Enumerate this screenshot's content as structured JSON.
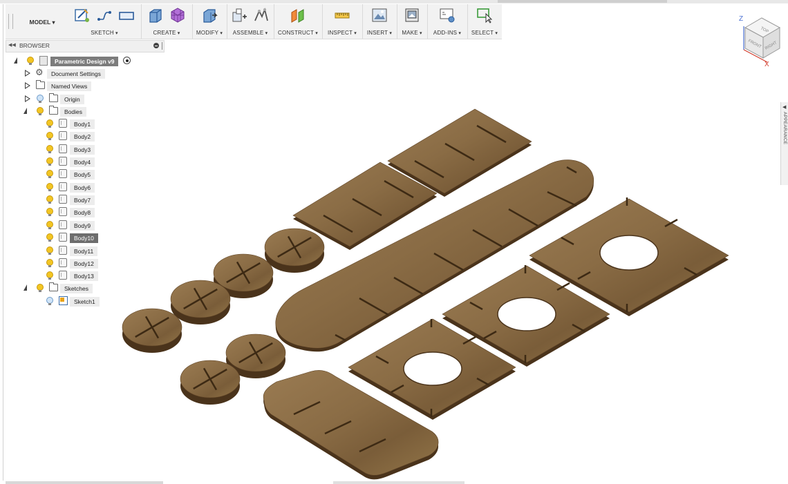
{
  "toolbar": {
    "workspace": "MODEL",
    "groups": [
      {
        "label": "SKETCH",
        "icons": [
          "create-sketch-icon",
          "line-icon",
          "rectangle-icon"
        ]
      },
      {
        "label": "CREATE",
        "icons": [
          "extrude-icon",
          "box-icon"
        ]
      },
      {
        "label": "MODIFY",
        "icons": [
          "press-pull-icon"
        ]
      },
      {
        "label": "ASSEMBLE",
        "icons": [
          "new-component-icon",
          "joint-icon"
        ]
      },
      {
        "label": "CONSTRUCT",
        "icons": [
          "offset-plane-icon"
        ]
      },
      {
        "label": "INSPECT",
        "icons": [
          "measure-icon"
        ]
      },
      {
        "label": "INSERT",
        "icons": [
          "insert-image-icon"
        ]
      },
      {
        "label": "MAKE",
        "icons": [
          "3d-print-icon"
        ]
      },
      {
        "label": "ADD-INS",
        "icons": [
          "scripts-icon"
        ]
      },
      {
        "label": "SELECT",
        "icons": [
          "select-icon"
        ]
      }
    ]
  },
  "browser": {
    "title": "BROWSER",
    "root": "Parametric Design v9",
    "document_settings": "Document Settings",
    "named_views": "Named Views",
    "origin": "Origin",
    "bodies_folder": "Bodies",
    "bodies": [
      "Body1",
      "Body2",
      "Body3",
      "Body4",
      "Body5",
      "Body6",
      "Body7",
      "Body8",
      "Body9",
      "Body10",
      "Body11",
      "Body12",
      "Body13"
    ],
    "selected_body": "Body10",
    "sketches_folder": "Sketches",
    "sketches": [
      "Sketch1"
    ]
  },
  "viewcube": {
    "top": "TOP",
    "front": "FRONT",
    "right": "RIGHT",
    "axis_z": "Z",
    "axis_x": "X"
  },
  "side_panel": {
    "label": "APPEARANCE"
  },
  "colors": {
    "wood": "#8a6c45",
    "wood_dark": "#5e4428",
    "wood_edge": "#3d2a14",
    "axis_z": "#4a6fd1",
    "axis_x": "#d23b2b"
  }
}
